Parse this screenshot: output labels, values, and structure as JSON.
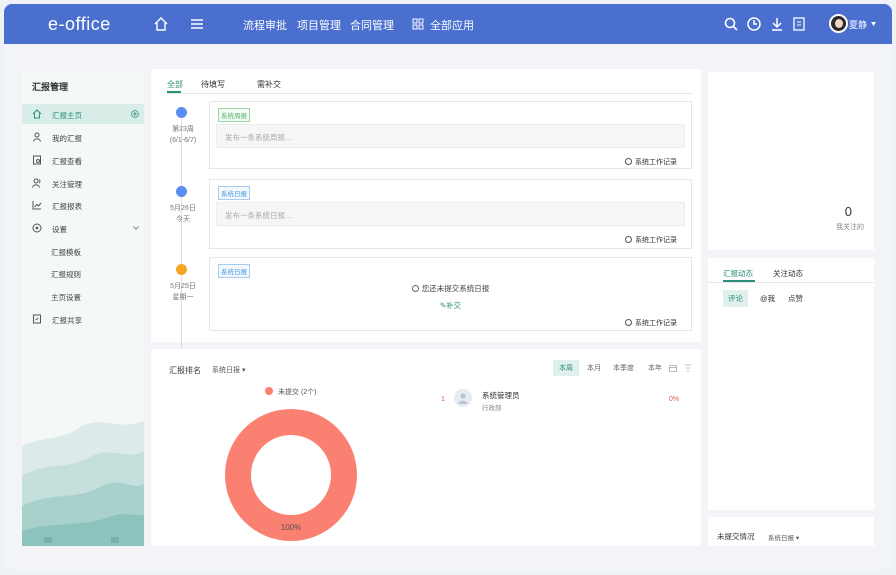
{
  "app": {
    "logo": "e-office",
    "user_name": "夏静"
  },
  "nav": {
    "items": [
      "流程审批",
      "项目管理",
      "合同管理"
    ],
    "all_apps": "全部应用"
  },
  "sidebar": {
    "title": "汇报管理",
    "items": [
      {
        "label": "汇报主页"
      },
      {
        "label": "我的汇报"
      },
      {
        "label": "汇报查看"
      },
      {
        "label": "关注管理"
      },
      {
        "label": "汇报报表"
      },
      {
        "label": "设置"
      }
    ],
    "sub_items": [
      "汇报模板",
      "汇报规则",
      "主页设置"
    ],
    "share": "汇报共享"
  },
  "main": {
    "tabs": [
      "全部",
      "待填写",
      "需补交"
    ],
    "entries": [
      {
        "date_line1": "第23周",
        "date_line2": "(6/1-6/7)",
        "tag": "系统周报",
        "placeholder": "发布一条系统周报...",
        "log": "系统工作记录"
      },
      {
        "date_line1": "5月26日",
        "date_line2": "今天",
        "tag": "系统日报",
        "placeholder": "发布一条系统日报...",
        "log": "系统工作记录"
      },
      {
        "date_line1": "5月25日",
        "date_line2": "星期一",
        "tag": "系统日报",
        "notice": "您还未提交系统日报",
        "submit": "补交",
        "log": "系统工作记录"
      }
    ]
  },
  "ranking": {
    "title": "汇报排名",
    "type": "系统日报",
    "periods": [
      "本周",
      "本月",
      "本季度",
      "本年"
    ],
    "legend": "未提交 (2个)",
    "donut_label": "100%",
    "rows": [
      {
        "rank": "1",
        "name": "系统管理员",
        "dept": "行政部",
        "percent": "0%"
      }
    ]
  },
  "chart_data": {
    "type": "pie",
    "categories": [
      "未提交 (2个)"
    ],
    "values": [
      100
    ],
    "colors": [
      "#fa8072"
    ]
  },
  "right": {
    "follow_count": "0",
    "follow_label": "我关注的",
    "activity_tabs": [
      "汇报动态",
      "关注动态"
    ],
    "filters": [
      "评论",
      "@我",
      "点赞"
    ],
    "unsubmitted_title": "未提交情况",
    "unsubmitted_type": "系统日报"
  },
  "colors": {
    "header": "#4a6fce",
    "accent": "#2a8f78",
    "donut": "#fa8072"
  }
}
